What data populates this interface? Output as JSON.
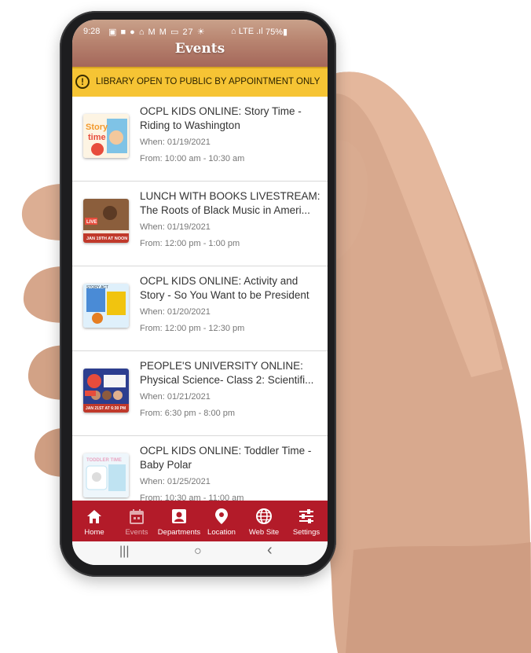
{
  "status_bar": {
    "time": "9:28",
    "icons": "▣ ■ ● ⌂ M M ▭ 27 ☀",
    "right": "⌂ LTE .ıl",
    "battery": "75%▮"
  },
  "header": {
    "title": "Events"
  },
  "notice": {
    "icon": "!",
    "text": "LIBRARY OPEN TO PUBLIC BY APPOINTMENT ONLY"
  },
  "events": [
    {
      "title": "OCPL KIDS ONLINE: Story Time - Riding to Washington",
      "when": "When: 01/19/2021",
      "from": "From: 10:00 am - 10:30 am",
      "thumb_text": "Story time",
      "thumb_color": "#f29a2e"
    },
    {
      "title": "LUNCH WITH BOOKS LIVESTREAM: The Roots of Black Music in Ameri...",
      "when": "When: 01/19/2021",
      "from": "From: 12:00 pm - 1:00 pm",
      "thumb_text": "JAN 19TH AT NOON",
      "thumb_color": "#c0392b"
    },
    {
      "title": "OCPL KIDS ONLINE: Activity and Story - So You Want to be President",
      "when": "When: 01/20/2021",
      "from": "From: 12:00 pm - 12:30 pm",
      "thumb_text": "STORY ACT",
      "thumb_color": "#4a8bd6"
    },
    {
      "title": "PEOPLE'S UNIVERSITY ONLINE: Physical Science- Class 2: Scientifi...",
      "when": "When: 01/21/2021",
      "from": "From: 6:30 pm - 8:00 pm",
      "thumb_text": "JAN 21ST AT 6:30 PM",
      "thumb_color": "#2c3e8f"
    },
    {
      "title": "OCPL KIDS ONLINE: Toddler Time - Baby Polar",
      "when": "When: 01/25/2021",
      "from": "From: 10:30 am - 11:00 am",
      "thumb_text": "TODDLER TIME",
      "thumb_color": "#bfe3f2"
    }
  ],
  "nav": [
    {
      "label": "Home",
      "icon": "home-icon",
      "active": true
    },
    {
      "label": "Events",
      "icon": "calendar-icon",
      "active": false
    },
    {
      "label": "Departments",
      "icon": "person-badge-icon",
      "active": true
    },
    {
      "label": "Location",
      "icon": "map-pin-icon",
      "active": true
    },
    {
      "label": "Web Site",
      "icon": "globe-icon",
      "active": true
    },
    {
      "label": "Settings",
      "icon": "sliders-icon",
      "active": true
    }
  ],
  "system_keys": {
    "recent": "|||",
    "home": "○",
    "back": "‹"
  },
  "colors": {
    "nav_background": "#b31b29",
    "notice_background": "#f6c434",
    "header_gradient_top": "#c9a18a",
    "header_gradient_bottom": "#a4675a"
  }
}
